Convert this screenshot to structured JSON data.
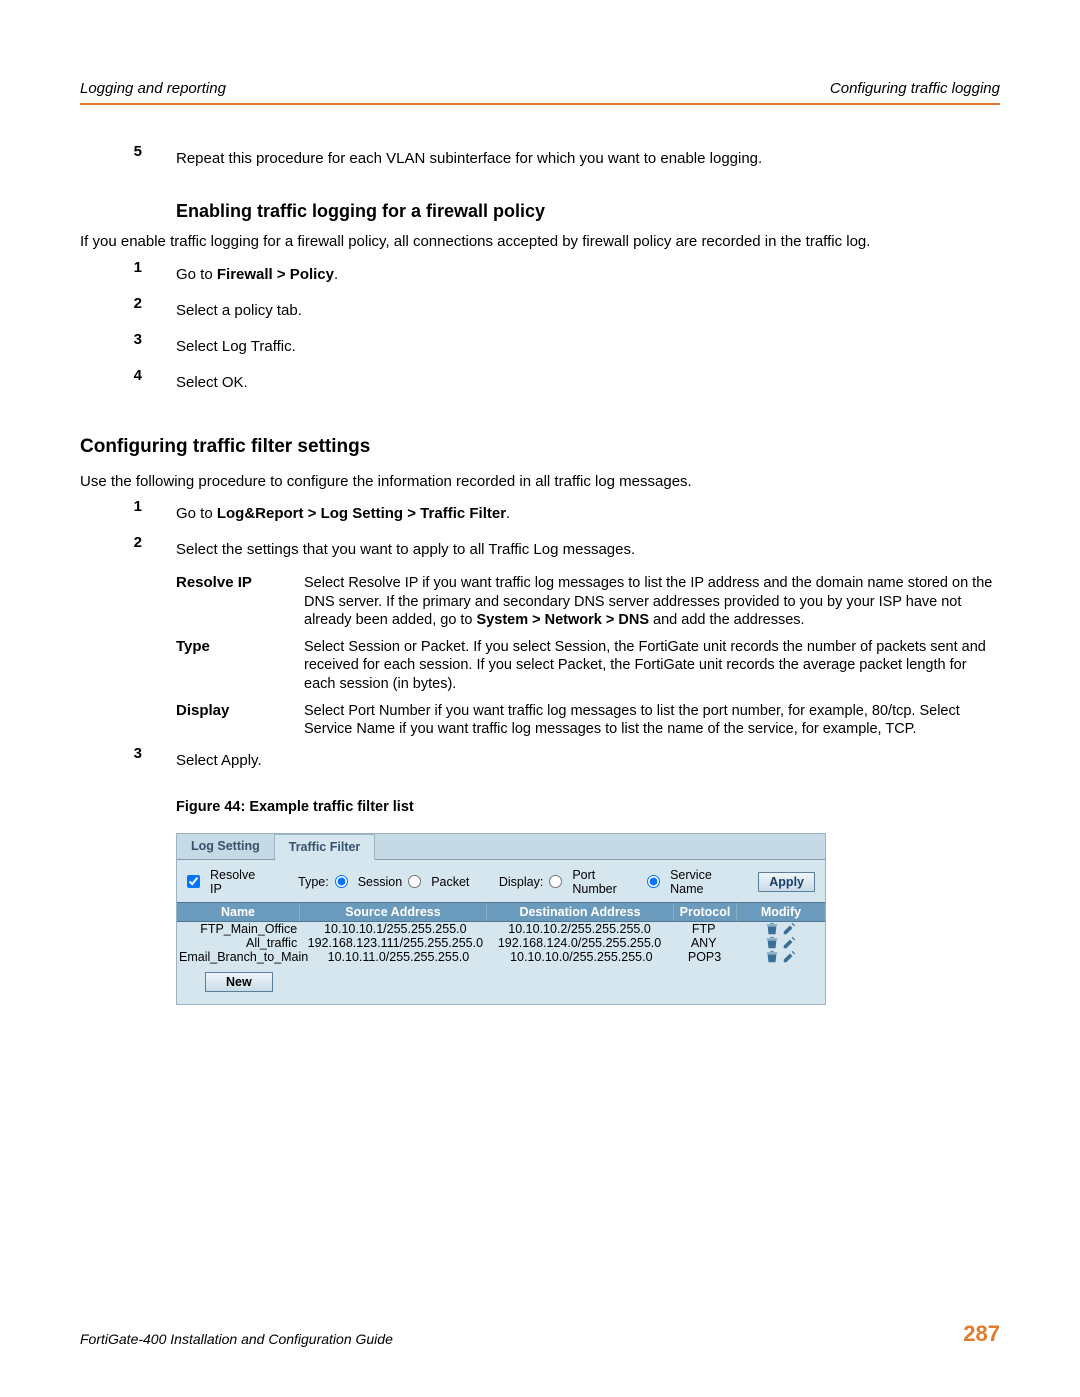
{
  "header": {
    "left": "Logging and reporting",
    "right": "Configuring traffic logging"
  },
  "step5": {
    "num": "5",
    "text": "Repeat this procedure for each VLAN subinterface for which you want to enable logging."
  },
  "policy": {
    "heading": "Enabling traffic logging for a firewall policy",
    "intro": "If you enable traffic logging for a firewall policy, all connections accepted by firewall policy are recorded in the traffic log.",
    "s1": {
      "num": "1",
      "pre": "Go to ",
      "bold": "Firewall > Policy",
      "post": "."
    },
    "s2": {
      "num": "2",
      "text": "Select a policy tab."
    },
    "s3": {
      "num": "3",
      "text": "Select Log Traffic."
    },
    "s4": {
      "num": "4",
      "text": "Select OK."
    }
  },
  "filter": {
    "heading": "Configuring traffic filter settings",
    "intro": "Use the following procedure to configure the information recorded in all traffic log messages.",
    "s1": {
      "num": "1",
      "pre": "Go to ",
      "bold": "Log&Report > Log Setting > Traffic Filter",
      "post": "."
    },
    "s2": {
      "num": "2",
      "text": "Select the settings that you want to apply to all Traffic Log messages."
    },
    "defs": {
      "resolve": {
        "term": "Resolve IP",
        "desc_a": "Select Resolve IP if you want traffic log messages to list the IP address and the domain name stored on the DNS server. If the primary and secondary DNS server addresses provided to you by your ISP have not already been added, go to ",
        "desc_bold": "System > Network > DNS",
        "desc_b": " and add the addresses."
      },
      "type": {
        "term": "Type",
        "desc": "Select Session or Packet. If you select Session, the FortiGate unit records the number of packets sent and received for each session. If you select Packet, the FortiGate unit records the average packet length for each session (in bytes)."
      },
      "display": {
        "term": "Display",
        "desc": "Select Port Number if you want traffic log messages to list the port number, for example, 80/tcp. Select Service Name if you want traffic log messages to list the name of the service, for example, TCP."
      }
    },
    "s3": {
      "num": "3",
      "text": "Select Apply."
    },
    "figcaption": "Figure 44: Example traffic filter list"
  },
  "shot": {
    "tabs": {
      "log_setting": "Log Setting",
      "traffic_filter": "Traffic Filter"
    },
    "controls": {
      "resolve_label": "Resolve IP",
      "type_label": "Type:",
      "session": "Session",
      "packet": "Packet",
      "display_label": "Display:",
      "port_number": "Port Number",
      "service_name": "Service Name",
      "apply": "Apply"
    },
    "cols": {
      "name": "Name",
      "src": "Source Address",
      "dst": "Destination Address",
      "proto": "Protocol",
      "modify": "Modify"
    },
    "rows": [
      {
        "name": "FTP_Main_Office",
        "src": "10.10.10.1/255.255.255.0",
        "dst": "10.10.10.2/255.255.255.0",
        "proto": "FTP"
      },
      {
        "name": "All_traffic",
        "src": "192.168.123.111/255.255.255.0",
        "dst": "192.168.124.0/255.255.255.0",
        "proto": "ANY"
      },
      {
        "name": "Email_Branch_to_Main",
        "src": "10.10.11.0/255.255.255.0",
        "dst": "10.10.10.0/255.255.255.0",
        "proto": "POP3"
      }
    ],
    "new_btn": "New"
  },
  "footer": {
    "left": "FortiGate-400 Installation and Configuration Guide",
    "page": "287"
  }
}
